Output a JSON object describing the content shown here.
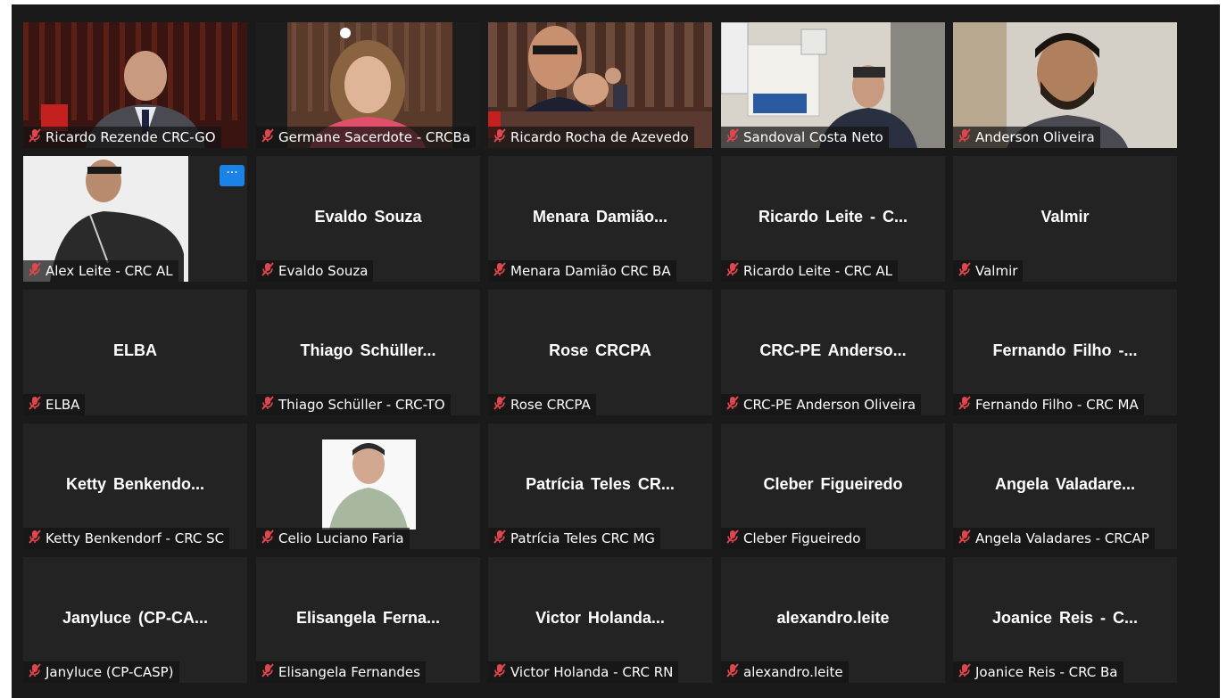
{
  "meeting": {
    "participants": [
      {
        "label": "Ricardo Rezende CRC-GO",
        "display": "",
        "video": "man-red-background",
        "muted": true
      },
      {
        "label": "Germane Sacerdote - CRCBa",
        "display": "",
        "video": "woman-curly-hair",
        "muted": true
      },
      {
        "label": "Ricardo Rocha de Azevedo",
        "display": "",
        "video": "man-glasses-auditorium",
        "muted": true
      },
      {
        "label": "Sandoval Costa Neto",
        "display": "",
        "video": "man-office-shelf",
        "muted": true
      },
      {
        "label": "Anderson Oliveira",
        "display": "",
        "video": "man-beard-light-wall",
        "muted": true
      },
      {
        "label": "Alex Leite - CRC AL",
        "display": "",
        "video": "man-white-room",
        "muted": true
      },
      {
        "label": "Evaldo Souza",
        "display": "Evaldo Souza",
        "video": "",
        "muted": true
      },
      {
        "label": "Menara Damião CRC BA",
        "display": "Menara  Damião...",
        "video": "",
        "muted": true
      },
      {
        "label": "Ricardo Leite - CRC AL",
        "display": "Ricardo Leite - C...",
        "video": "",
        "muted": true
      },
      {
        "label": "Valmir",
        "display": "Valmir",
        "video": "",
        "muted": true
      },
      {
        "label": "ELBA",
        "display": "ELBA",
        "video": "",
        "muted": true
      },
      {
        "label": "Thiago Schüller - CRC-TO",
        "display": "Thiago  Schüller...",
        "video": "",
        "muted": true
      },
      {
        "label": "Rose CRCPA",
        "display": "Rose CRCPA",
        "video": "",
        "muted": true
      },
      {
        "label": "CRC-PE Anderson Oliveira",
        "display": "CRC-PE  Anderso...",
        "video": "",
        "muted": true
      },
      {
        "label": "Fernando Filho - CRC MA",
        "display": "Fernando Filho -...",
        "video": "",
        "muted": true
      },
      {
        "label": "Ketty Benkendorf - CRC SC",
        "display": "Ketty  Benkendo...",
        "video": "",
        "muted": true
      },
      {
        "label": "Celio Luciano Faria",
        "display": "",
        "video": "profile-photo",
        "muted": true
      },
      {
        "label": "Patrícia Teles CRC MG",
        "display": "Patrícia Teles CR...",
        "video": "",
        "muted": true
      },
      {
        "label": "Cleber Figueiredo",
        "display": "Cleber Figueiredo",
        "video": "",
        "muted": true
      },
      {
        "label": "Angela Valadares - CRCAP",
        "display": "Angela  Valadare...",
        "video": "",
        "muted": true
      },
      {
        "label": "Janyluce (CP-CASP)",
        "display": "Janyluce  (CP-CA...",
        "video": "",
        "muted": true
      },
      {
        "label": "Elisangela Fernandes",
        "display": "Elisangela  Ferna...",
        "video": "",
        "muted": true
      },
      {
        "label": "Victor Holanda - CRC RN",
        "display": "Victor  Holanda...",
        "video": "",
        "muted": true
      },
      {
        "label": "alexandro.leite",
        "display": "alexandro.leite",
        "video": "",
        "muted": true
      },
      {
        "label": "Joanice Reis - CRC Ba",
        "display": "Joanice Reis - C...",
        "video": "",
        "muted": true
      }
    ],
    "more_button": "···",
    "colors": {
      "background": "#1a1a1a",
      "tile": "#232323",
      "muted_icon": "#e0464e",
      "more_button": "#1b82e8"
    },
    "icons": {
      "muted": "muted-microphone-icon",
      "more": "more-options-icon"
    }
  }
}
